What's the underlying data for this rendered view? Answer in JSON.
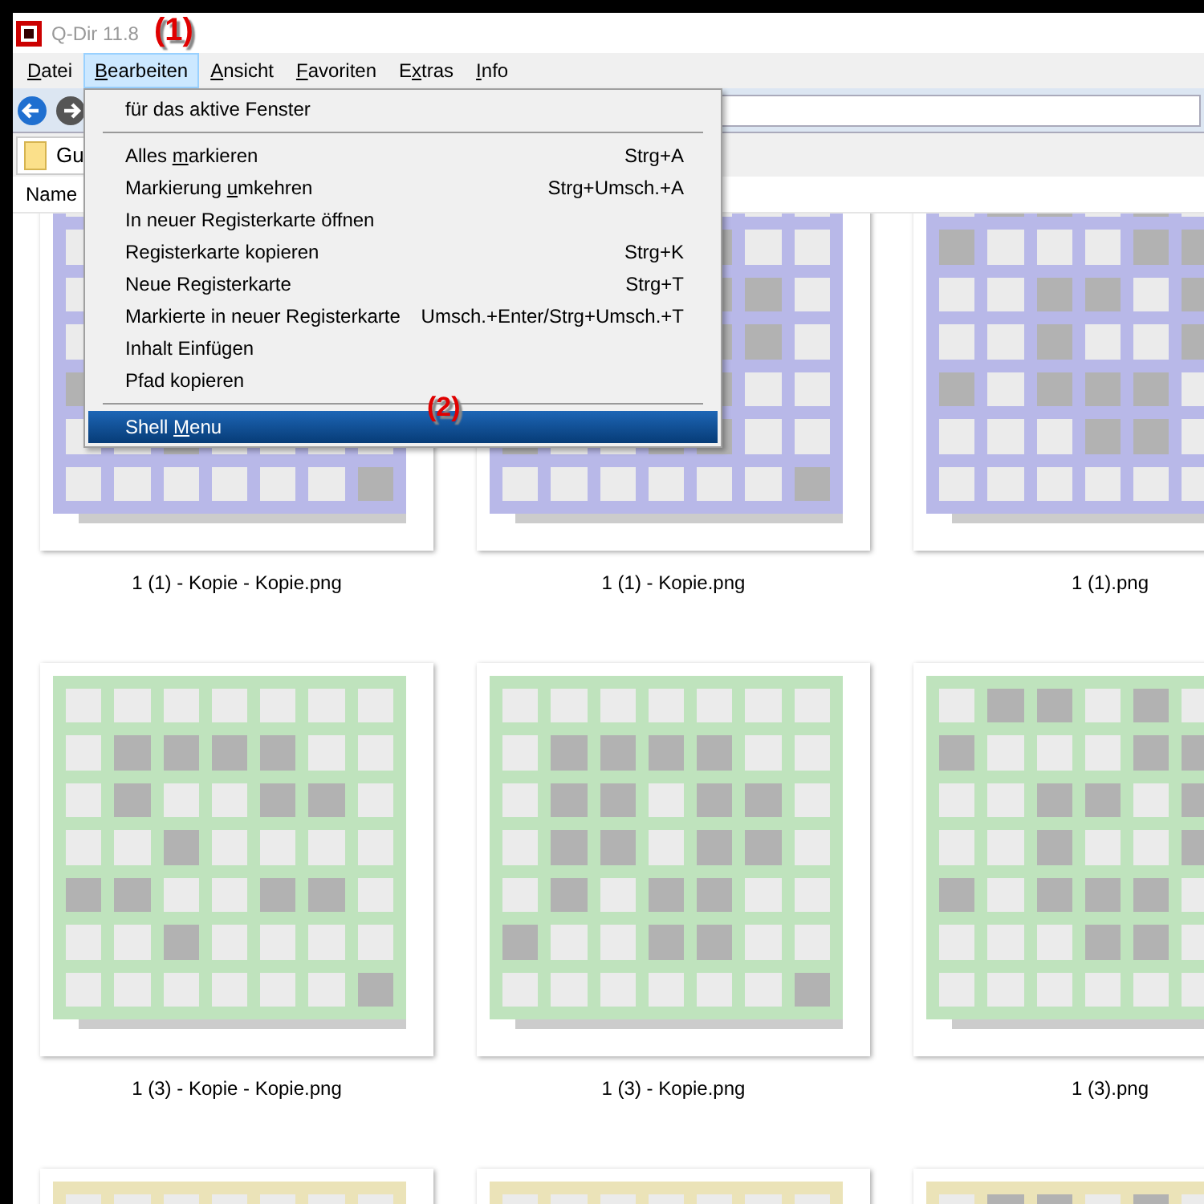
{
  "window": {
    "title": "Q-Dir 11.8"
  },
  "menu_bar": [
    {
      "key": "D",
      "after": "atei",
      "selected": false
    },
    {
      "key": "B",
      "after": "earbeiten",
      "selected": true
    },
    {
      "key": "A",
      "after": "nsicht",
      "selected": false
    },
    {
      "key": "F",
      "after": "avoriten",
      "selected": false
    },
    {
      "before": "E",
      "key": "x",
      "after": "tras",
      "selected": false
    },
    {
      "key": "I",
      "after": "nfo",
      "selected": false
    }
  ],
  "tab": {
    "label": "Gu"
  },
  "column_header": {
    "label": "Name"
  },
  "dropdown": [
    {
      "kind": "item",
      "label": "für das aktive Fenster",
      "selected": false
    },
    {
      "kind": "separator"
    },
    {
      "kind": "item",
      "before": "Alles ",
      "key": "m",
      "after": "arkieren",
      "shortcut": "Strg+A",
      "selected": false
    },
    {
      "kind": "item",
      "before": "Markierung ",
      "key": "u",
      "after": "mkehren",
      "shortcut": "Strg+Umsch.+A",
      "selected": false
    },
    {
      "kind": "item",
      "label": "In neuer Registerkarte öffnen",
      "selected": false
    },
    {
      "kind": "item",
      "label": "Registerkarte kopieren",
      "shortcut": "Strg+K",
      "selected": false
    },
    {
      "kind": "item",
      "label": "Neue Registerkarte",
      "shortcut": "Strg+T",
      "selected": false
    },
    {
      "kind": "item",
      "label": "Markierte in neuer Registerkarte",
      "shortcut": "Umsch.+Enter/Strg+Umsch.+T",
      "selected": false
    },
    {
      "kind": "item",
      "label": "Inhalt Einfügen",
      "selected": false
    },
    {
      "kind": "item",
      "label": "Pfad kopieren",
      "selected": false
    },
    {
      "kind": "separator"
    },
    {
      "kind": "item",
      "before": "Shell ",
      "key": "M",
      "after": "enu",
      "selected": true
    }
  ],
  "annotations": [
    "(1)",
    "(2)"
  ],
  "files": [
    {
      "name": "1 (1) - Kopie - Kopie.png",
      "color": "#b8b8e8"
    },
    {
      "name": "1 (1) - Kopie.png",
      "color": "#b8b8e8"
    },
    {
      "name": "1 (1).png",
      "color": "#b8b8e8"
    },
    {
      "name": "1 (3) - Kopie - Kopie.png",
      "color": "#bfe3bd"
    },
    {
      "name": "1 (3) - Kopie.png",
      "color": "#bfe3bd"
    },
    {
      "name": "1 (3).png",
      "color": "#bfe3bd"
    },
    {
      "color": "#ebe3b8"
    },
    {
      "color": "#ebe3b8"
    },
    {
      "color": "#ebe3b8"
    }
  ]
}
